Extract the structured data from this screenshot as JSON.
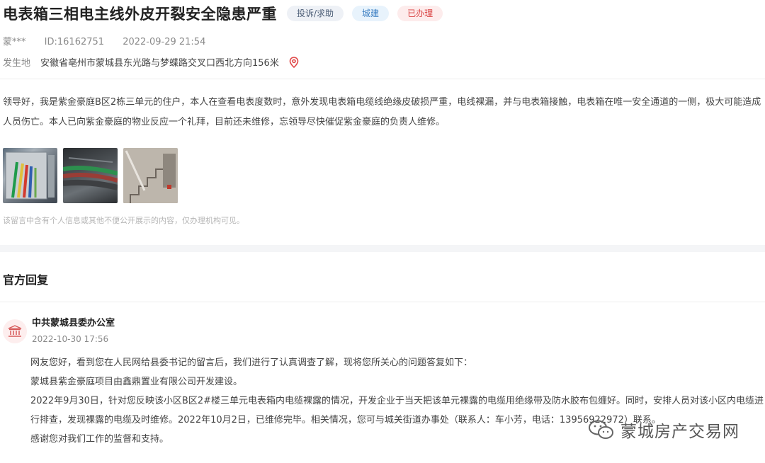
{
  "post": {
    "title": "电表箱三相电主线外皮开裂安全隐患严重",
    "tags": {
      "type": "投诉/求助",
      "category": "城建",
      "status": "已办理"
    },
    "author": "蒙***",
    "id_text": "ID:16162751",
    "datetime": "2022-09-29 21:54",
    "location_label": "发生地",
    "location_value": "安徽省亳州市蒙城县东光路与梦蝶路交叉口西北方向156米",
    "content": "领导好，我是紫金豪庭B区2栋三单元的住户，本人在查看电表度数时，意外发现电表箱电缆线绝缘皮破损严重，电线裸漏，并与电表箱接触，电表箱在唯一安全通道的一侧，极大可能造成人员伤亡。本人已向紫金豪庭的物业反应一个礼拜，目前还未维修，忘领导尽快催促紫金豪庭的负责人维修。",
    "privacy_notice": "该留言中含有个人信息或其他不便公开展示的内容，仅办理机构可见。"
  },
  "reply": {
    "section_title": "官方回复",
    "org": "中共蒙城县委办公室",
    "datetime": "2022-10-30 17:56",
    "paragraphs": [
      "网友您好，看到您在人民网给县委书记的留言后，我们进行了认真调查了解，现将您所关心的问题答复如下：",
      "蒙城县紫金豪庭项目由鑫鼎置业有限公司开发建设。",
      "2022年9月30日，针对您反映该小区B区2#楼三单元电表箱内电缆裸露的情况，开发企业于当天把该单元裸露的电缆用绝缘带及防水胶布包缠好。同时，安排人员对该小区内电缆进行排查，发现裸露的电缆及时维修。2022年10月2日，已维修完毕。相关情况，您可与城关街道办事处（联系人：车小芳，电话：13956922972）联系。",
      "感谢您对我们工作的监督和支持。"
    ]
  },
  "watermark": {
    "text": "蒙城房产交易网",
    "icon": "wechat-icon"
  },
  "icons": {
    "location": "location-pin-icon",
    "org_avatar": "government-building-icon"
  },
  "colors": {
    "status_red": "#d94040",
    "category_blue": "#3c7fc2",
    "pin_red": "#e04848"
  }
}
